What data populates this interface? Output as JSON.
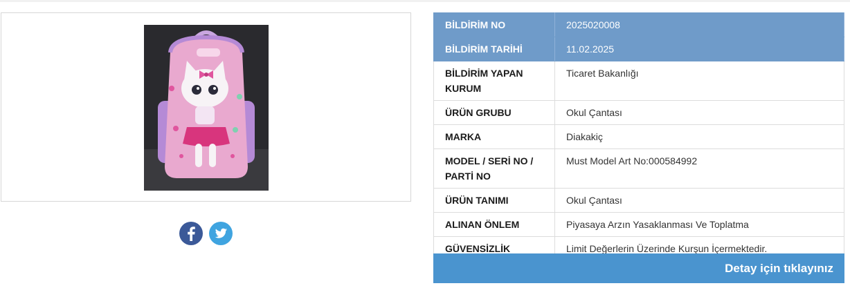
{
  "product": {
    "image_alt": "School backpack with cat design"
  },
  "social": {
    "facebook_icon": "facebook-icon",
    "twitter_icon": "twitter-icon"
  },
  "notification": {
    "rows": [
      {
        "label": "BİLDİRİM NO",
        "value": "2025020008"
      },
      {
        "label": "BİLDİRİM TARİHİ",
        "value": "11.02.2025"
      },
      {
        "label": "BİLDİRİM YAPAN KURUM",
        "value": "Ticaret Bakanlığı"
      },
      {
        "label": "ÜRÜN GRUBU",
        "value": "Okul Çantası"
      },
      {
        "label": "MARKA",
        "value": "Diakakiç"
      },
      {
        "label": "MODEL / SERİ NO / PARTİ NO",
        "value": "Must Model Art No:000584992"
      },
      {
        "label": "ÜRÜN TANIMI",
        "value": "Okul Çantası"
      },
      {
        "label": "ALINAN ÖNLEM",
        "value": "Piyasaya Arzın Yasaklanması Ve Toplatma"
      },
      {
        "label": "GÜVENSİZLİK NEDENİ",
        "value": "Limit Değerlerin Üzerinde Kurşun İçermektedir."
      }
    ]
  },
  "detail_button": {
    "label": "Detay için tıklayınız"
  },
  "colors": {
    "header_row": "#6f9bc9",
    "button": "#4a94cf",
    "facebook": "#3b5998",
    "twitter": "#3fa4e0"
  }
}
